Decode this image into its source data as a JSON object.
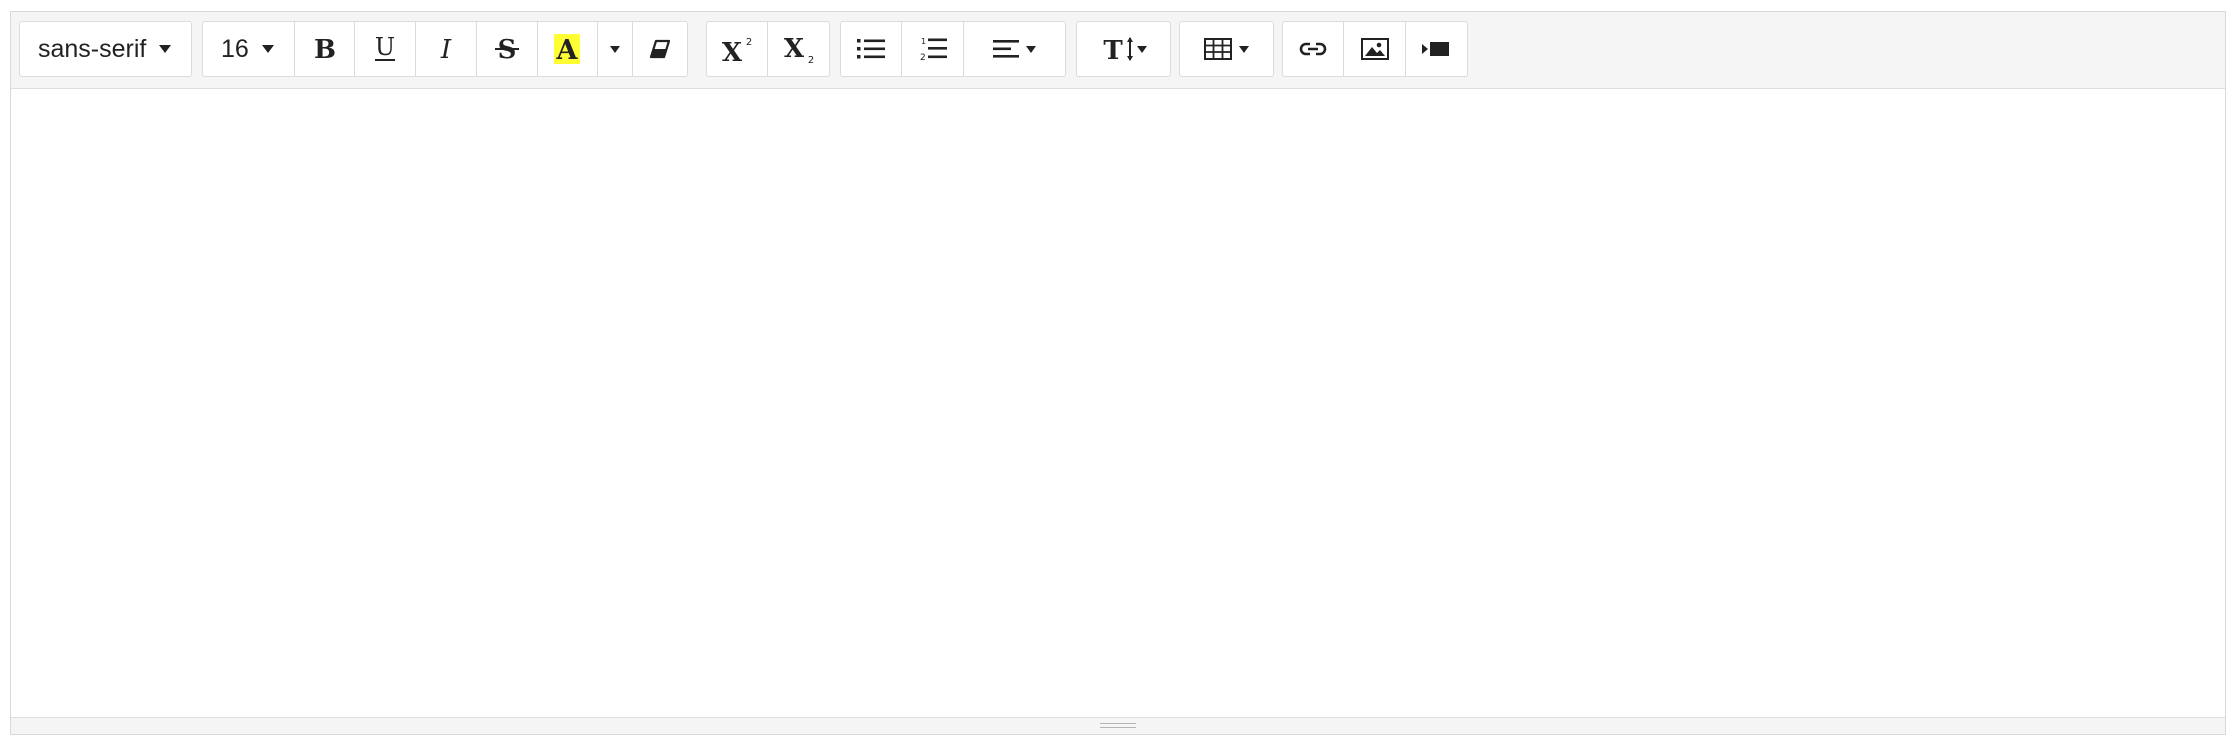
{
  "toolbar": {
    "font_family": {
      "value": "sans-serif",
      "icon": "chevron-down-icon"
    },
    "font_size": {
      "value": "16",
      "icon": "chevron-down-icon"
    },
    "buttons": {
      "bold": "bold-icon",
      "underline": "underline-icon",
      "italic": "italic-icon",
      "strikethrough": "strikethrough-icon",
      "highlight": "text-color-icon",
      "highlight_dropdown": "chevron-down-icon",
      "clear_format": "eraser-icon",
      "superscript": "superscript-icon",
      "subscript": "subscript-icon",
      "unordered_list": "bullet-list-icon",
      "ordered_list": "numbered-list-icon",
      "align": "align-left-icon",
      "line_height": "line-height-icon",
      "table": "table-icon",
      "link": "link-icon",
      "image": "image-icon",
      "video": "video-icon"
    }
  },
  "colors": {
    "toolbar_bg": "#f5f5f5",
    "border": "#d9d9d9",
    "highlight_yellow": "#ffff00",
    "icon": "#222222"
  },
  "editor": {
    "content": ""
  }
}
